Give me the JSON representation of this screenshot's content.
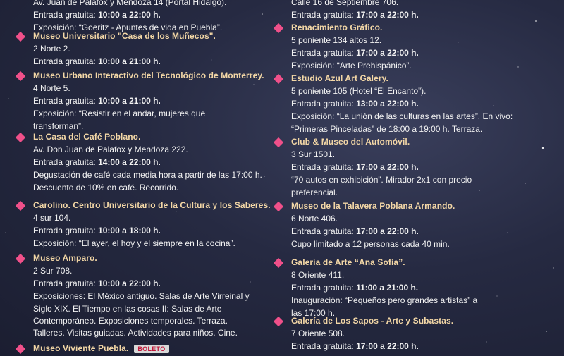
{
  "left": [
    {
      "name": "",
      "lines": [
        "Av. Juan de Palafox y Mendoza 14 (Portal Hidalgo)."
      ],
      "entry_label": "Entrada gratuita: ",
      "hours": "10:00 a 22:00 h.",
      "extra": [
        "Exposición: “Goeritz - Apuntes de vida en Puebla”."
      ]
    },
    {
      "name": "Museo Universitario \"Casa de los Muñecos\".",
      "lines": [
        "2 Norte 2."
      ],
      "entry_label": "Entrada gratuita: ",
      "hours": "10:00 a 21:00 h.",
      "extra": []
    },
    {
      "name": "Museo Urbano Interactivo del Tecnológico de Monterrey.",
      "lines": [
        "4 Norte 5."
      ],
      "entry_label": "Entrada gratuita: ",
      "hours": "10:00 a 21:00 h.",
      "extra": [
        "Exposición: “Resistir en el andar, mujeres que",
        "transforman”."
      ]
    },
    {
      "name": "La Casa del Café Poblano.",
      "lines": [
        "Av. Don Juan de Palafox y Mendoza 222."
      ],
      "entry_label": "Entrada gratuita: ",
      "hours": "14:00 a 22:00 h.",
      "extra": [
        "Degustación de café cada media hora a partir de las 17:00 h.",
        "Descuento de 10% en café. Recorrido."
      ]
    },
    {
      "name": "Carolino. Centro Universitario de la Cultura y los Saberes.",
      "lines": [
        "4 sur 104."
      ],
      "entry_label": "Entrada gratuita: ",
      "hours": "10:00 a 18:00 h.",
      "extra": [
        "Exposición: “El ayer, el hoy y el siempre en la cocina”."
      ]
    },
    {
      "name": "Museo Amparo.",
      "lines": [
        "2 Sur 708."
      ],
      "entry_label": "Entrada gratuita: ",
      "hours": "10:00 a 22:00 h.",
      "extra": [
        "Exposiciones: El México antiguo. Salas de Arte Virreinal y",
        "Siglo XIX. El Tiempo en las cosas II: Salas de Arte",
        "Contemporáneo. Exposiciones temporales. Terraza.",
        "Talleres. Visitas guiadas. Actividades para niños. Cine."
      ]
    },
    {
      "name": "Museo Viviente Puebla.",
      "badge": "BOLETO",
      "lines": [],
      "entry_label": "",
      "hours": "",
      "extra": []
    }
  ],
  "right": [
    {
      "name": "",
      "lines": [
        "Calle 16 de Septiembre 706."
      ],
      "entry_label": "Entrada gratuita: ",
      "hours": "17:00 a 22:00 h.",
      "extra": []
    },
    {
      "name": "Renacimiento Gráfico.",
      "lines": [
        "5 poniente 134 altos 12."
      ],
      "entry_label": "Entrada gratuita: ",
      "hours": "17:00 a 22:00 h.",
      "extra": [
        "Exposición: “Arte Prehispánico”."
      ]
    },
    {
      "name": "Estudio Azul Art Galery.",
      "lines": [
        "5 poniente 105 (Hotel “El Encanto”)."
      ],
      "entry_label": "Entrada gratuita: ",
      "hours": "13:00 a 22:00 h.",
      "extra": [
        "Exposición: “La unión de las culturas en las artes”. En vivo:",
        "“Primeras Pinceladas” de 18:00 a 19:00 h. Terraza."
      ]
    },
    {
      "name": "Club & Museo del Automóvil.",
      "lines": [
        "3 Sur 1501."
      ],
      "entry_label": "Entrada gratuita: ",
      "hours": "17:00 a 22:00 h.",
      "extra": [
        "“70 autos en exhibición”. Mirador 2x1 con precio",
        "preferencial."
      ]
    },
    {
      "name": "Museo de la Talavera Poblana Armando.",
      "lines": [
        "6 Norte 406."
      ],
      "entry_label": "Entrada gratuita: ",
      "hours": "17:00 a 22:00 h.",
      "extra": [
        "Cupo limitado a 12 personas cada 40 min."
      ]
    },
    {
      "name": "Galería de Arte “Ana Sofía”.",
      "lines": [
        "8 Oriente 411."
      ],
      "entry_label": "Entrada gratuita: ",
      "hours": "11:00 a 21:00 h.",
      "extra": [
        "Inauguración: “Pequeños pero grandes artistas” a",
        "las 17:00 h."
      ]
    },
    {
      "name": "Galería de Los Sapos - Arte y Subastas.",
      "lines": [
        "7 Oriente 508."
      ],
      "entry_label": "Entrada gratuita: ",
      "hours": "17:00 a 22:00 h.",
      "extra": []
    }
  ]
}
